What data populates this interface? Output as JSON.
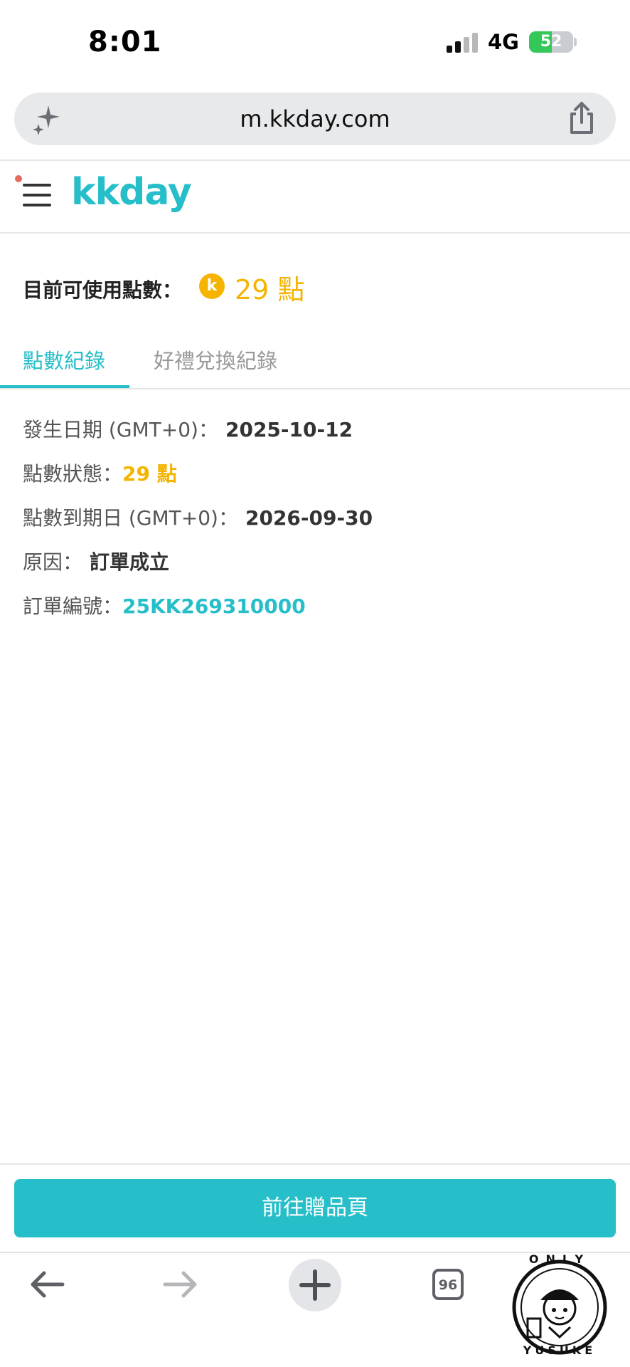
{
  "status_bar": {
    "time": "8:01",
    "network": "4G",
    "battery_level": 52,
    "battery_text": "52"
  },
  "browser": {
    "url": "m.kkday.com",
    "tab_count": "96",
    "icons": [
      "sparkle-icon",
      "share-icon",
      "back-arrow-icon",
      "forward-arrow-icon",
      "plus-icon",
      "tabs-icon"
    ]
  },
  "site": {
    "logo_text": "kkday"
  },
  "points": {
    "label": "目前可使用點數：",
    "coin_letter": "k",
    "value": "29 點"
  },
  "tabs": [
    {
      "label": "點數紀錄",
      "active": true
    },
    {
      "label": "好禮兌換紀錄",
      "active": false
    }
  ],
  "record": {
    "date_label": "發生日期 (GMT+0)：",
    "date_value": "2025-10-12",
    "status_label": "點數狀態：",
    "status_value": "29 點",
    "expiry_label": "點數到期日 (GMT+0)：",
    "expiry_value": "2026-09-30",
    "reason_label": "原因：",
    "reason_value": "訂單成立",
    "order_label": "訂單編號：",
    "order_value": "25KK269310000"
  },
  "cta": {
    "label": "前往贈品頁"
  },
  "watermark": {
    "top_text": "ONLY",
    "bottom_text": "YUSUKE"
  },
  "colors": {
    "brand_teal": "#26bec9",
    "points_yellow": "#f4b400"
  }
}
